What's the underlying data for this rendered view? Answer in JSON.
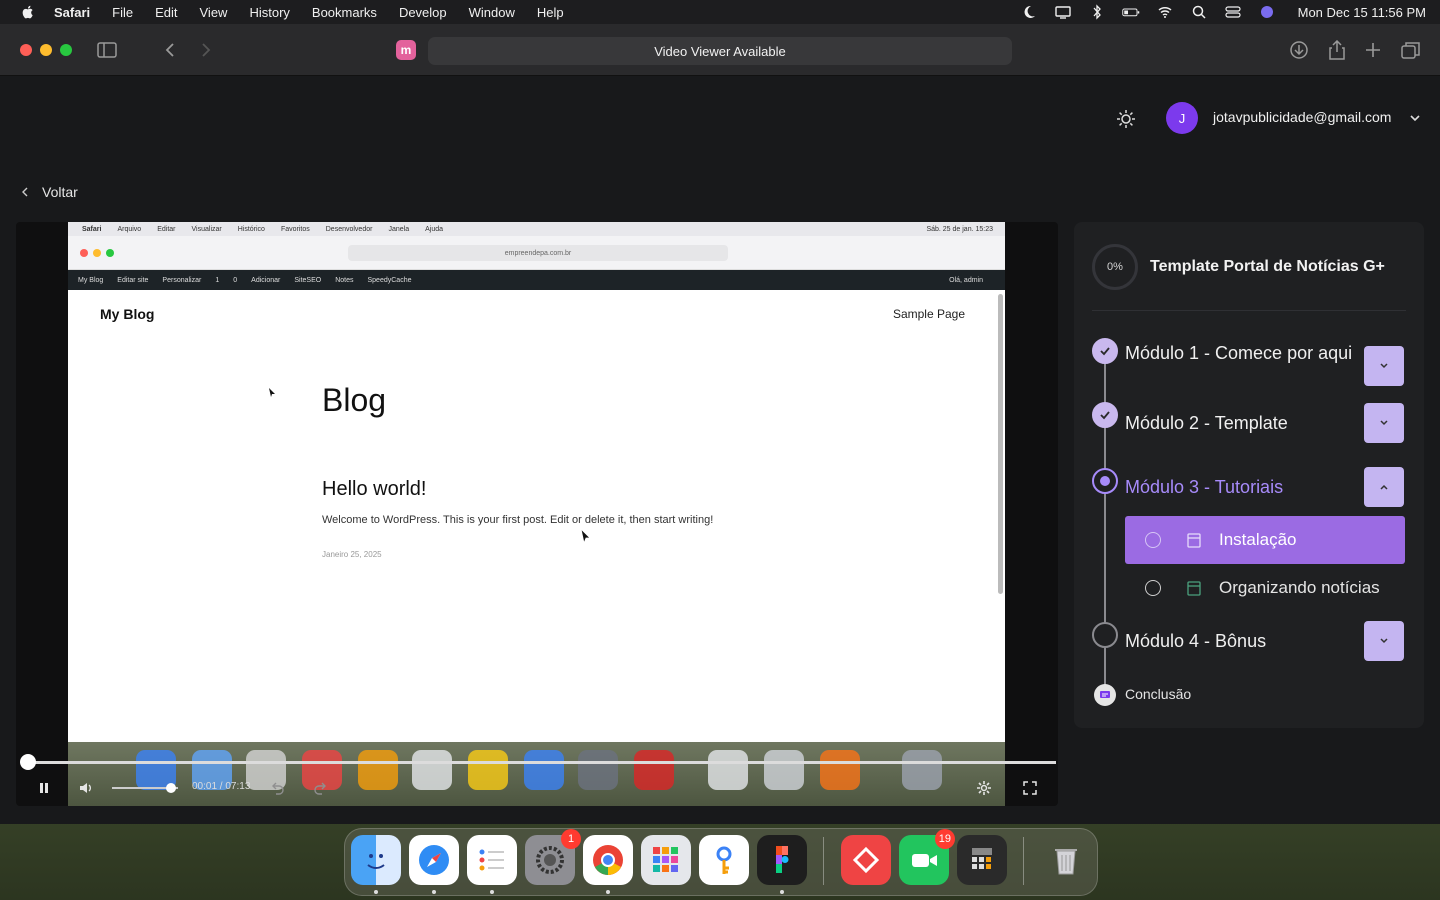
{
  "menubar": {
    "app": "Safari",
    "items": [
      "File",
      "Edit",
      "View",
      "History",
      "Bookmarks",
      "Develop",
      "Window",
      "Help"
    ],
    "clock": "Mon Dec 15  11:56 PM"
  },
  "browser": {
    "address": "Video Viewer Available",
    "extension_letter": "m"
  },
  "header": {
    "avatar_letter": "J",
    "email": "jotavpublicidade@gmail.com"
  },
  "nav": {
    "back_label": "Voltar"
  },
  "video": {
    "time": "00:01 / 07:13",
    "progress_fraction": 0.002,
    "volume_fraction": 0.9,
    "frame": {
      "menubar": [
        "Safari",
        "Arquivo",
        "Editar",
        "Visualizar",
        "Histórico",
        "Favoritos",
        "Desenvolvedor",
        "Janela",
        "Ajuda"
      ],
      "clock": "Sáb. 25 de jan. 15:23",
      "url": "empreendepa.com.br",
      "wp_bar": [
        "My Blog",
        "Editar site",
        "Personalizar",
        "1",
        "0",
        "Adicionar",
        "SiteSEO",
        "Notes",
        "SpeedyCache"
      ],
      "wp_user": "Olá, admin",
      "site_title": "My Blog",
      "sample_page": "Sample Page",
      "blog_heading": "Blog",
      "post_title": "Hello world!",
      "post_excerpt": "Welcome to WordPress. This is your first post. Edit or delete it, then start writing!",
      "post_date": "Janeiro 25, 2025"
    }
  },
  "course": {
    "progress": "0%",
    "title": "Template Portal de Notícias G+",
    "modules": [
      {
        "label": "Módulo 1 - Comece por aqui",
        "state": "done"
      },
      {
        "label": "Módulo 2 - Template",
        "state": "done"
      },
      {
        "label": "Módulo 3 - Tutoriais",
        "state": "active"
      },
      {
        "label": "Módulo 4 - Bônus",
        "state": "pending"
      }
    ],
    "lessons": [
      {
        "label": "Instalação",
        "active": true
      },
      {
        "label": "Organizando notícias",
        "active": false
      }
    ],
    "conclusion": "Conclusão"
  },
  "dock": {
    "apps": [
      "finder",
      "safari",
      "reminders",
      "system-settings",
      "chrome",
      "launchpad",
      "keychain",
      "figma",
      "anydesk",
      "facetime",
      "calculator",
      "trash"
    ],
    "badges": {
      "system-settings": "1",
      "facetime": "19"
    }
  },
  "colors": {
    "accent": "#7c3aed",
    "accent_light": "#a78bfa",
    "active_lesson": "#9b6be3"
  }
}
